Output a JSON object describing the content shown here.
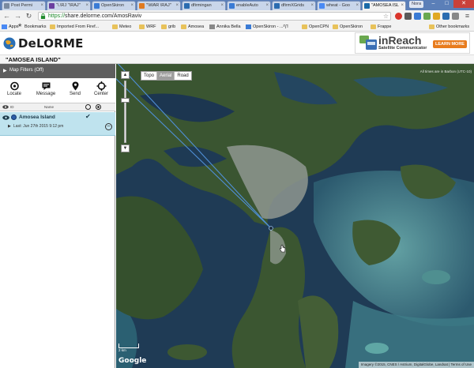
{
  "browser": {
    "tabs": [
      {
        "label": "Post Permi",
        "active": false,
        "color": "#7a8aa0"
      },
      {
        "label": "“\\.\\RJ ''\\RAJ''",
        "active": false,
        "color": "#6b3fa0"
      },
      {
        "label": "OpenSkiron",
        "active": false,
        "color": "#3a7bd5"
      },
      {
        "label": "''\\WAR \\RAJ''",
        "active": false,
        "color": "#e07b22"
      },
      {
        "label": "dfirmingan",
        "active": false,
        "color": "#2b6cb0"
      },
      {
        "label": "enableAuto",
        "active": false,
        "color": "#3a7bd5"
      },
      {
        "label": "dfirmXGrids",
        "active": false,
        "color": "#2b6cb0"
      },
      {
        "label": "wheat - Goo",
        "active": false,
        "color": "#4a8af4"
      },
      {
        "label": "\"AMOSEA ISL",
        "active": true,
        "color": "#1a6aa8"
      }
    ],
    "user_badge": "Nora",
    "url_https": "https://",
    "url_rest": "share.delorme.com/AmosRaviv",
    "bookmarks": [
      {
        "label": "Apps",
        "type": "apps"
      },
      {
        "label": "Bookmarks",
        "type": "star"
      },
      {
        "label": "Imported From Firef...",
        "type": "folder"
      },
      {
        "label": "Meteo",
        "type": "folder"
      },
      {
        "label": "WRF",
        "type": "folder"
      },
      {
        "label": "grib",
        "type": "folder"
      },
      {
        "label": "Amosea",
        "type": "folder"
      },
      {
        "label": "Annika Bella",
        "type": "page"
      },
      {
        "label": "OpenSkiron - ...דף",
        "type": "page"
      },
      {
        "label": "OpenCPN",
        "type": "folder"
      },
      {
        "label": "OpenSkiron",
        "type": "folder"
      },
      {
        "label": "Frappe",
        "type": "folder"
      }
    ],
    "other_bookmarks": "Other bookmarks"
  },
  "header": {
    "logo_text": "DeLORME",
    "ad_title": "inReach",
    "ad_subtitle": "Satellite Communicator",
    "ad_button": "LEARN MORE"
  },
  "map_title": "\"AMOSEA ISLAND\"",
  "panel": {
    "filters_label": "Map Filters (Off)",
    "actions": [
      {
        "label": "Locate",
        "icon": "locate-icon"
      },
      {
        "label": "Message",
        "icon": "message-icon"
      },
      {
        "label": "Send",
        "icon": "send-icon"
      },
      {
        "label": "Center",
        "icon": "center-icon"
      }
    ],
    "col_id": "ID",
    "col_name": "Name",
    "device_name": "Amosea Island",
    "last_seen": "Last: Jun 27th 2015 9:12 pm"
  },
  "map": {
    "types": [
      "Topo",
      "Aerial",
      "Road"
    ],
    "selected_type": "Aerial",
    "tz_note": "All times are in Barbon (UTC-10)",
    "scale_label": "2 km",
    "google": "Google",
    "attribution": "Imagery ©2015, CNES / Astrium, DigitalGlobe, Landsat | Terms of Use",
    "colors": {
      "deep_water": "#1f3b55",
      "shallow_water": "#4e8f93",
      "land": "#3b5530",
      "town": "#8f9891",
      "track_line": "#4f8fd6"
    }
  }
}
